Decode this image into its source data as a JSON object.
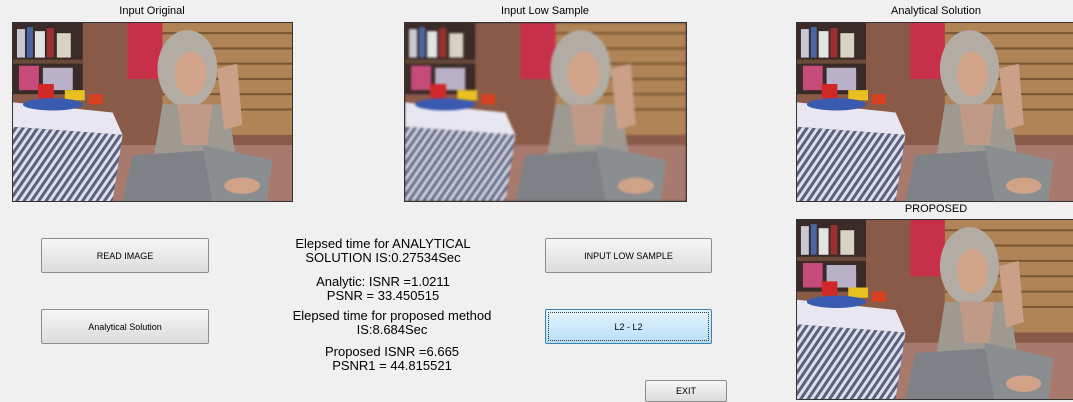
{
  "panels": {
    "original_title": "Input Original",
    "low_sample_title": "Input Low Sample",
    "analytical_title": "Analytical Solution",
    "proposed_title": "PROPOSED"
  },
  "buttons": {
    "read_image": "READ IMAGE",
    "analytical_solution": "Analytical Solution",
    "input_low_sample": "INPUT LOW SAMPLE",
    "l2_l2": "L2 - L2",
    "exit": "EXIT"
  },
  "results": {
    "analytical_time_line1": "Elepsed time for ANALYTICAL",
    "analytical_time_line2": "SOLUTION IS:0.27534Sec",
    "analytic_isnr": "Analytic: ISNR =1.0211",
    "analytic_psnr": "PSNR = 33.450515",
    "proposed_time_line1": "Elepsed time for proposed method",
    "proposed_time_line2": "IS:8.684Sec",
    "proposed_isnr": "Proposed ISNR =6.665",
    "proposed_psnr": "PSNR1 = 44.815521"
  }
}
